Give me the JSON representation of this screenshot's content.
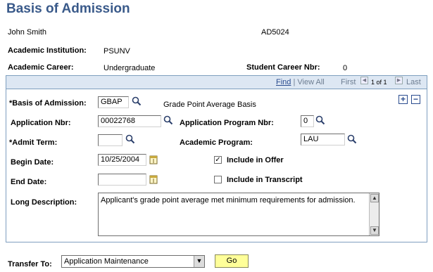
{
  "page": {
    "title": "Basis of Admission"
  },
  "student": {
    "name": "John Smith",
    "id": "AD5024"
  },
  "institution": {
    "label": "Academic Institution:",
    "value": "PSUNV"
  },
  "career": {
    "label": "Academic Career:",
    "value": "Undergraduate",
    "nbr_label": "Student Career Nbr:",
    "nbr_value": "0"
  },
  "scroll_nav": {
    "find": "Find",
    "view_all": "View All",
    "first": "First",
    "position": "1 of 1",
    "last": "Last"
  },
  "form": {
    "basis_label": "*Basis of Admission:",
    "basis_value": "GBAP",
    "basis_desc": "Grade Point Average Basis",
    "app_nbr_label": "Application Nbr:",
    "app_nbr_value": "00022768",
    "app_prog_nbr_label": "Application Program Nbr:",
    "app_prog_nbr_value": "0",
    "admit_term_label": "*Admit Term:",
    "admit_term_value": "",
    "acad_prog_label": "Academic Program:",
    "acad_prog_value": "LAU",
    "begin_date_label": "Begin Date:",
    "begin_date_value": "10/25/2004",
    "end_date_label": "End Date:",
    "end_date_value": "",
    "include_offer_label": "Include in Offer",
    "include_offer_checked": true,
    "include_transcript_label": "Include in Transcript",
    "include_transcript_checked": false,
    "long_desc_label": "Long Description:",
    "long_desc_value": "Applicant's grade point average met minimum requirements for admission."
  },
  "footer": {
    "transfer_label": "Transfer To:",
    "transfer_value": "Application Maintenance",
    "go_label": "Go"
  },
  "colors": {
    "title": "#3a5a8a",
    "header_bg": "#dde7f3",
    "go_bg": "#ffff99"
  },
  "icons": [
    "search-icon",
    "calendar-icon",
    "add-icon",
    "delete-icon",
    "previous-icon",
    "next-icon",
    "chevron-down-icon"
  ]
}
